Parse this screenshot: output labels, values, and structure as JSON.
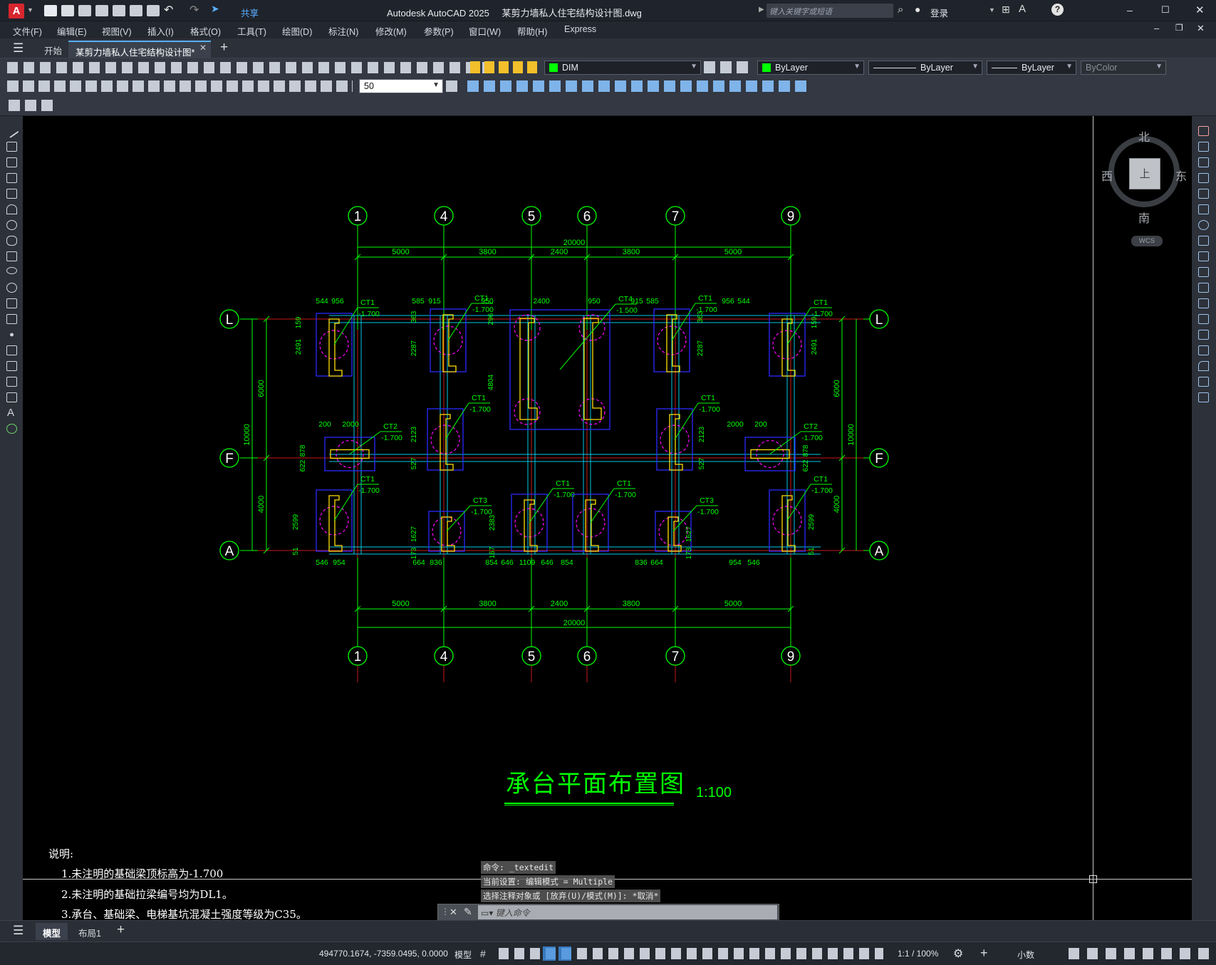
{
  "app": {
    "title": "Autodesk AutoCAD 2025",
    "document": "某剪力墙私人住宅结构设计图.dwg",
    "logo": "A",
    "share_label": "共享",
    "search_placeholder": "键入关键字或短语",
    "login_label": "登录"
  },
  "menu": [
    "文件(F)",
    "编辑(E)",
    "视图(V)",
    "插入(I)",
    "格式(O)",
    "工具(T)",
    "绘图(D)",
    "标注(N)",
    "修改(M)",
    "参数(P)",
    "窗口(W)",
    "帮助(H)",
    "Express"
  ],
  "tabs": [
    {
      "label": "开始",
      "active": false
    },
    {
      "label": "某剪力墙私人住宅结构设计图*",
      "active": true
    }
  ],
  "toolbar": {
    "layer": "DIM",
    "color": "ByLayer",
    "linetype": "ByLayer",
    "lineweight": "ByLayer",
    "plotstyle": "ByColor",
    "dimscale": "50"
  },
  "viewcube": {
    "north": "北",
    "south": "南",
    "east": "东",
    "west": "西",
    "wcs": "WCS",
    "face": "上"
  },
  "drawing": {
    "axes_x": [
      "1",
      "4",
      "5",
      "6",
      "7",
      "9"
    ],
    "axes_y": [
      "L",
      "F",
      "A"
    ],
    "dims_top_total": "20000",
    "dims_top": [
      "5000",
      "3800",
      "2400",
      "3800",
      "5000"
    ],
    "dims_bottom": [
      "5000",
      "3800",
      "2400",
      "3800",
      "5000"
    ],
    "dims_bottom_total": "20000",
    "dims_left": [
      "6000",
      "4000"
    ],
    "dims_left_total": "10000",
    "dims_right": [
      "6000",
      "4000"
    ],
    "dims_right_total": "10000",
    "caps": [
      {
        "id": "L1",
        "label": "CT1",
        "elev": "-1.700"
      },
      {
        "id": "L4",
        "label": "CT1",
        "elev": "-1.700"
      },
      {
        "id": "L56",
        "label": "CT4",
        "elev": "-1.500"
      },
      {
        "id": "L7",
        "label": "CT1",
        "elev": "-1.700"
      },
      {
        "id": "L9",
        "label": "CT1",
        "elev": "-1.700"
      },
      {
        "id": "F1",
        "label": "CT2",
        "elev": "-1.700"
      },
      {
        "id": "F4",
        "label": "CT1",
        "elev": "-1.700"
      },
      {
        "id": "F7",
        "label": "CT1",
        "elev": "-1.700"
      },
      {
        "id": "F9",
        "label": "CT2",
        "elev": "-1.700"
      },
      {
        "id": "A1",
        "label": "CT1",
        "elev": "-1.700"
      },
      {
        "id": "A4",
        "label": "CT3",
        "elev": "-1.700"
      },
      {
        "id": "A5",
        "label": "CT1",
        "elev": "-1.700"
      },
      {
        "id": "A6",
        "label": "CT1",
        "elev": "-1.700"
      },
      {
        "id": "A7",
        "label": "CT3",
        "elev": "-1.700"
      },
      {
        "id": "A9",
        "label": "CT1",
        "elev": "-1.700"
      }
    ],
    "small_dims": {
      "top": [
        "544",
        "956",
        "585",
        "915",
        "950",
        "2400",
        "950",
        "915",
        "585",
        "956",
        "544"
      ],
      "bottom": [
        "546",
        "954",
        "664",
        "836",
        "854",
        "646",
        "1109",
        "646",
        "854",
        "836",
        "664",
        "954",
        "546"
      ],
      "ct2": [
        "200",
        "2000",
        "2000",
        "200"
      ],
      "vert": [
        "159",
        "2491",
        "363",
        "2287",
        "296",
        "4804",
        "2287",
        "363",
        "2491",
        "159",
        "878",
        "622",
        "2123",
        "527",
        "2123",
        "527",
        "878",
        "622",
        "2599",
        "51",
        "1627",
        "173",
        "2383",
        "167",
        "1627",
        "173",
        "2599",
        "51"
      ]
    },
    "title": "承台平面布置图",
    "scale": "1:100",
    "notes_title": "说明:",
    "notes": [
      "1.未注明的基础梁顶标高为-1.700",
      "2.未注明的基础拉梁编号均为DL1。",
      "3.承台、基础梁、电梯基坑混凝土强度等级为C35。"
    ]
  },
  "command": {
    "history": [
      "命令: _textedit",
      "当前设置: 编辑模式 = Multiple",
      "选择注释对象或 [放弃(U)/模式(M)]: *取消*"
    ],
    "placeholder": "键入命令"
  },
  "layouts": [
    "模型",
    "布局1"
  ],
  "status": {
    "coords": "494770.1674, -7359.0495, 0.0000",
    "model": "模型",
    "scale": "1:1 / 100%",
    "units": "小数"
  },
  "colors": {
    "canvas": "#000000",
    "green": "#00ff00",
    "cyan": "#00c8e6",
    "blue": "#2a2aff",
    "yellow": "#ffe000",
    "magenta": "#ff00ff",
    "red": "#ff2020"
  }
}
